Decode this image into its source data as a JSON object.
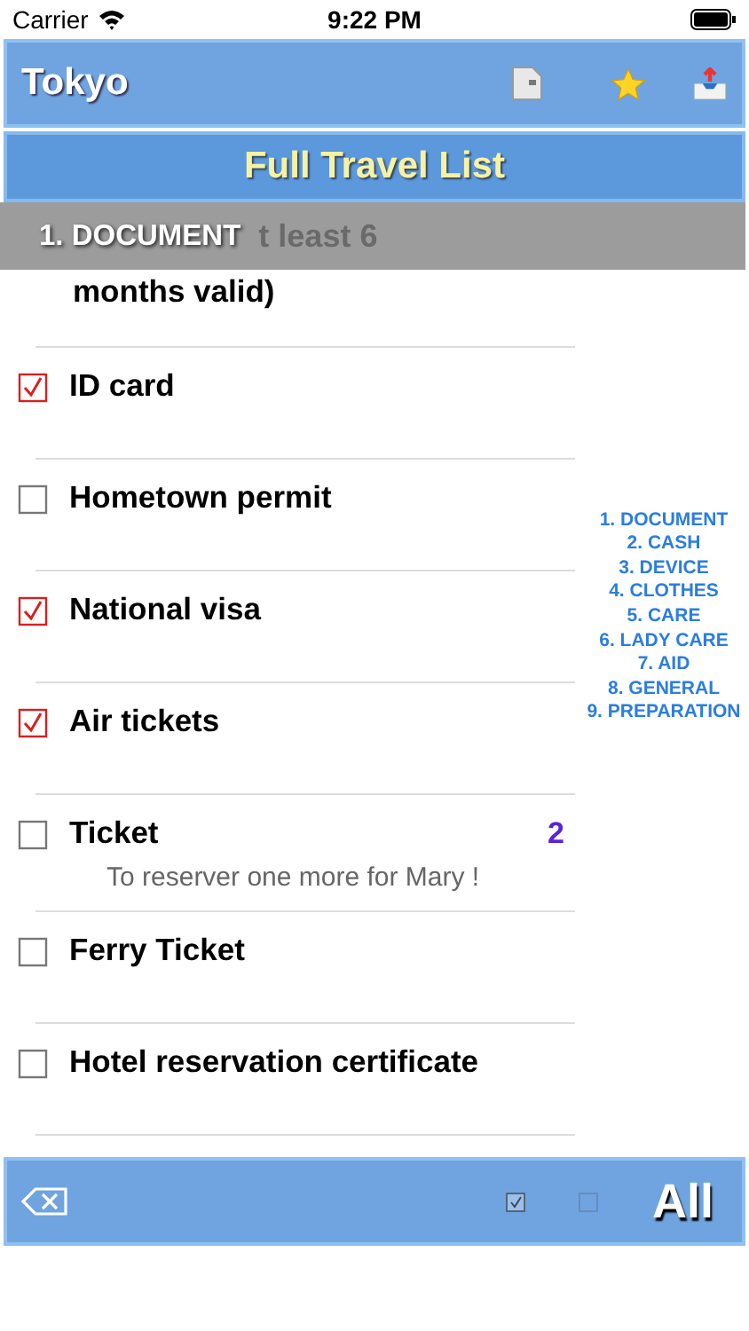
{
  "status_bar": {
    "carrier": "Carrier",
    "time": "9:22 PM"
  },
  "nav": {
    "title": "Tokyo"
  },
  "list_title": "Full Travel List",
  "section_header": "1. DOCUMENT",
  "covered_item": {
    "covered_text": "t least 6",
    "text": "months valid)"
  },
  "items": [
    {
      "text": "ID card",
      "checked": true
    },
    {
      "text": "Hometown permit",
      "checked": false
    },
    {
      "text": "National visa",
      "checked": true
    },
    {
      "text": "Air tickets",
      "checked": true
    },
    {
      "text": "Ticket",
      "checked": false,
      "count": "2",
      "note": "To reserver one more for Mary !"
    },
    {
      "text": "Ferry Ticket",
      "checked": false
    },
    {
      "text": "Hotel reservation certificate",
      "checked": false
    }
  ],
  "index": [
    "1. DOCUMENT",
    "2. CASH",
    "3. DEVICE",
    "4. CLOTHES",
    "5. CARE",
    "6. LADY CARE",
    "7. AID",
    "8. GENERAL",
    "9. PREPARATION"
  ],
  "toolbar": {
    "all_label": "All"
  }
}
